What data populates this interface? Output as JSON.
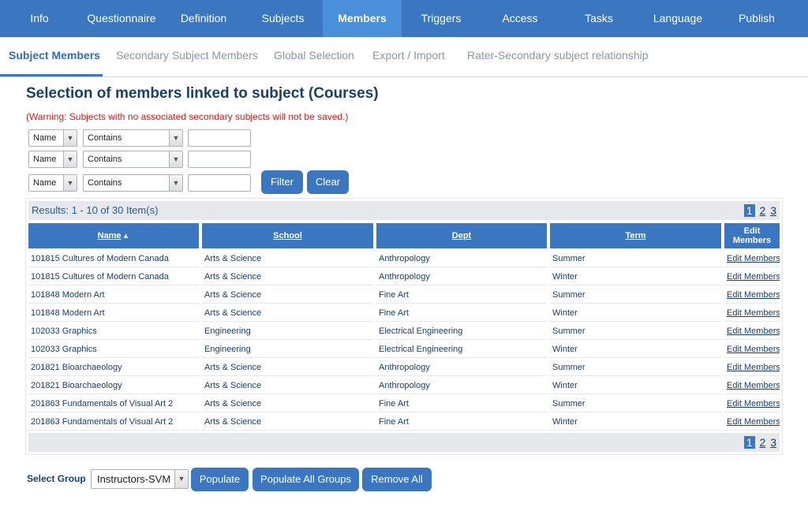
{
  "topnav": {
    "tabs": [
      {
        "label": "Info"
      },
      {
        "label": "Questionnaire"
      },
      {
        "label": "Definition"
      },
      {
        "label": "Subjects"
      },
      {
        "label": "Members"
      },
      {
        "label": "Triggers"
      },
      {
        "label": "Access"
      },
      {
        "label": "Tasks"
      },
      {
        "label": "Language"
      },
      {
        "label": "Publish"
      }
    ],
    "active": "Members"
  },
  "subnav": {
    "tabs": [
      {
        "label": "Subject Members"
      },
      {
        "label": "Secondary Subject Members"
      },
      {
        "label": "Global Selection"
      },
      {
        "label": "Export / Import"
      },
      {
        "label": "Rater-Secondary subject relationship"
      }
    ],
    "active": "Subject Members"
  },
  "page": {
    "title": "Selection of members linked to subject (Courses)",
    "warning": "(Warning: Subjects with no associated secondary subjects will not be saved.)"
  },
  "filters": [
    {
      "field": "Name",
      "operator": "Contains",
      "value": ""
    },
    {
      "field": "Name",
      "operator": "Contains",
      "value": ""
    },
    {
      "field": "Name",
      "operator": "Contains",
      "value": ""
    }
  ],
  "filter_buttons": {
    "filter": "Filter",
    "clear": "Clear"
  },
  "grid": {
    "results_text": "Results: 1 - 10 of 30 Item(s)",
    "pages": [
      "1",
      "2",
      "3"
    ],
    "current_page": "1",
    "columns": {
      "name": "Name",
      "sort_glyph": "▲",
      "school": "School",
      "dept": "Dept",
      "term": "Term",
      "edit_line1": "Edit",
      "edit_line2": "Members"
    },
    "rows": [
      {
        "name": "101815 Cultures of Modern Canada",
        "school": "Arts & Science",
        "dept": "Anthropology",
        "term": "Summer",
        "action": "Edit Members"
      },
      {
        "name": "101815 Cultures of Modern Canada",
        "school": "Arts & Science",
        "dept": "Anthropology",
        "term": "Winter",
        "action": "Edit Members"
      },
      {
        "name": "101848 Modern Art",
        "school": "Arts & Science",
        "dept": "Fine Art",
        "term": "Summer",
        "action": "Edit Members"
      },
      {
        "name": "101848 Modern Art",
        "school": "Arts & Science",
        "dept": "Fine Art",
        "term": "Winter",
        "action": "Edit Members"
      },
      {
        "name": "102033 Graphics",
        "school": "Engineering",
        "dept": "Electrical Engineering",
        "term": "Summer",
        "action": "Edit Members"
      },
      {
        "name": "102033 Graphics",
        "school": "Engineering",
        "dept": "Electrical Engineering",
        "term": "Winter",
        "action": "Edit Members"
      },
      {
        "name": "201821 Bioarchaeology",
        "school": "Arts & Science",
        "dept": "Anthropology",
        "term": "Summer",
        "action": "Edit Members"
      },
      {
        "name": "201821 Bioarchaeology",
        "school": "Arts & Science",
        "dept": "Anthropology",
        "term": "Winter",
        "action": "Edit Members"
      },
      {
        "name": "201863 Fundamentals of Visual Art 2",
        "school": "Arts & Science",
        "dept": "Fine Art",
        "term": "Summer",
        "action": "Edit Members"
      },
      {
        "name": "201863 Fundamentals of Visual Art 2",
        "school": "Arts & Science",
        "dept": "Fine Art",
        "term": "Winter",
        "action": "Edit Members"
      }
    ]
  },
  "bottom": {
    "select_group_label": "Select Group",
    "group_value": "Instructors-SVM",
    "populate": "Populate",
    "populate_all": "Populate All Groups",
    "remove_all": "Remove All"
  },
  "icons": {
    "dropdown": "chevron-down-icon"
  },
  "colors": {
    "primary": "#3a77c0",
    "active_tab": "#4a8fd9",
    "warning": "#d41b1b",
    "title": "#17406f"
  }
}
